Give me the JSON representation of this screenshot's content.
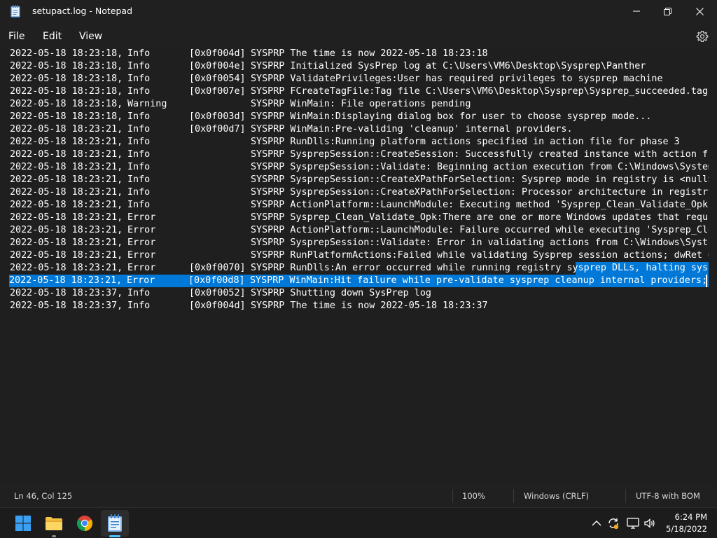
{
  "window": {
    "title": "setupact.log - Notepad",
    "accent_color": "#0078d7"
  },
  "menu": {
    "file": "File",
    "edit": "Edit",
    "view": "View"
  },
  "log_lines": [
    {
      "date": "2022-05-18 18:23:18,",
      "level": "Info",
      "code": "[0x0f004d]",
      "message": "SYSPRP The time is now 2022-05-18 18:23:18"
    },
    {
      "date": "2022-05-18 18:23:18,",
      "level": "Info",
      "code": "[0x0f004e]",
      "message": "SYSPRP Initialized SysPrep log at C:\\Users\\VM6\\Desktop\\Sysprep\\Panther"
    },
    {
      "date": "2022-05-18 18:23:18,",
      "level": "Info",
      "code": "[0x0f0054]",
      "message": "SYSPRP ValidatePrivileges:User has required privileges to sysprep machine"
    },
    {
      "date": "2022-05-18 18:23:18,",
      "level": "Info",
      "code": "[0x0f007e]",
      "message": "SYSPRP FCreateTagFile:Tag file C:\\Users\\VM6\\Desktop\\Sysprep\\Sysprep_succeeded.tag"
    },
    {
      "date": "2022-05-18 18:23:18,",
      "level": "Warning",
      "code": "",
      "message": "SYSPRP WinMain: File operations pending"
    },
    {
      "date": "2022-05-18 18:23:18,",
      "level": "Info",
      "code": "[0x0f003d]",
      "message": "SYSPRP WinMain:Displaying dialog box for user to choose sysprep mode..."
    },
    {
      "date": "2022-05-18 18:23:21,",
      "level": "Info",
      "code": "[0x0f00d7]",
      "message": "SYSPRP WinMain:Pre-validing 'cleanup' internal providers."
    },
    {
      "date": "2022-05-18 18:23:21,",
      "level": "Info",
      "code": "",
      "message": "SYSPRP RunDlls:Running platform actions specified in action file for phase 3"
    },
    {
      "date": "2022-05-18 18:23:21,",
      "level": "Info",
      "code": "",
      "message": "SYSPRP SysprepSession::CreateSession: Successfully created instance with action fi"
    },
    {
      "date": "2022-05-18 18:23:21,",
      "level": "Info",
      "code": "",
      "message": "SYSPRP SysprepSession::Validate: Beginning action execution from C:\\Windows\\System"
    },
    {
      "date": "2022-05-18 18:23:21,",
      "level": "Info",
      "code": "",
      "message": "SYSPRP SysprepSession::CreateXPathForSelection: Sysprep mode in registry is <null>"
    },
    {
      "date": "2022-05-18 18:23:21,",
      "level": "Info",
      "code": "",
      "message": "SYSPRP SysprepSession::CreateXPathForSelection: Processor architecture in registry"
    },
    {
      "date": "2022-05-18 18:23:21,",
      "level": "Info",
      "code": "",
      "message": "SYSPRP ActionPlatform::LaunchModule: Executing method 'Sysprep_Clean_Validate_Opk"
    },
    {
      "date": "2022-05-18 18:23:21,",
      "level": "Error",
      "code": "",
      "message": "SYSPRP Sysprep_Clean_Validate_Opk:There are one or more Windows updates that requi"
    },
    {
      "date": "2022-05-18 18:23:21,",
      "level": "Error",
      "code": "",
      "message": "SYSPRP ActionPlatform::LaunchModule: Failure occurred while executing 'Sysprep_Cle"
    },
    {
      "date": "2022-05-18 18:23:21,",
      "level": "Error",
      "code": "",
      "message": "SYSPRP SysprepSession::Validate: Error in validating actions from C:\\Windows\\Syste"
    },
    {
      "date": "2022-05-18 18:23:21,",
      "level": "Error",
      "code": "",
      "message": "SYSPRP RunPlatformActions:Failed while validating Sysprep session actions; dwRet ="
    },
    {
      "date": "2022-05-18 18:23:21,",
      "level": "Error",
      "code": "[0x0f0070]",
      "message": "SYSPRP RunDlls:An error occurred while running registry sysprep DLLs, halting sysp"
    },
    {
      "date": "2022-05-18 18:23:21,",
      "level": "Error",
      "code": "[0x0f00d8]",
      "message": "SYSPRP WinMain:Hit failure while pre-validate sysprep cleanup internal providers; h"
    },
    {
      "date": "2022-05-18 18:23:37,",
      "level": "Info",
      "code": "[0x0f0052]",
      "message": "SYSPRP Shutting down SysPrep log"
    },
    {
      "date": "2022-05-18 18:23:37,",
      "level": "Info",
      "code": "[0x0f004d]",
      "message": "SYSPRP The time is now 2022-05-18 18:23:37"
    }
  ],
  "status": {
    "position": "Ln 46, Col 125",
    "zoom": "100%",
    "line_ending": "Windows (CRLF)",
    "encoding": "UTF-8 with BOM"
  },
  "taskbar": {
    "icons": [
      "windows-start-icon",
      "file-explorer-icon",
      "chrome-icon",
      "notepad-icon"
    ],
    "time": "6:24 PM",
    "date": "5/18/2022"
  }
}
